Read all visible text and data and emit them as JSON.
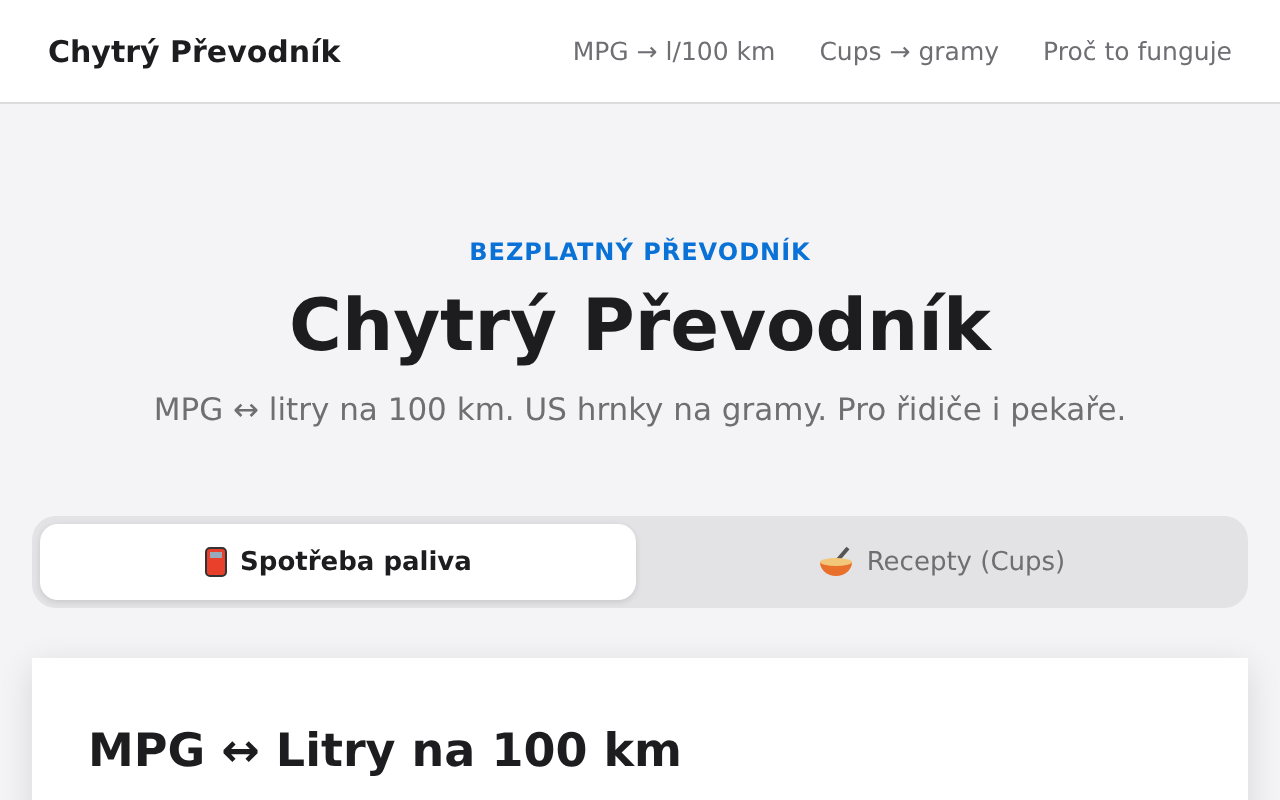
{
  "header": {
    "brand": "Chytrý Převodník",
    "nav": [
      "MPG → l/100 km",
      "Cups → gramy",
      "Proč to funguje"
    ]
  },
  "hero": {
    "eyebrow": "BEZPLATNÝ PŘEVODNÍK",
    "title": "Chytrý Převodník",
    "subtitle": "MPG ↔ litry na 100 km. US hrnky na gramy. Pro řidiče i pekaře."
  },
  "tabs": [
    {
      "label": "Spotřeba paliva",
      "kind": "fuel",
      "selected": true
    },
    {
      "label": "Recepty (Cups)",
      "kind": "bowl",
      "selected": false
    }
  ],
  "card": {
    "heading": "MPG ↔ Litry na 100 km"
  }
}
